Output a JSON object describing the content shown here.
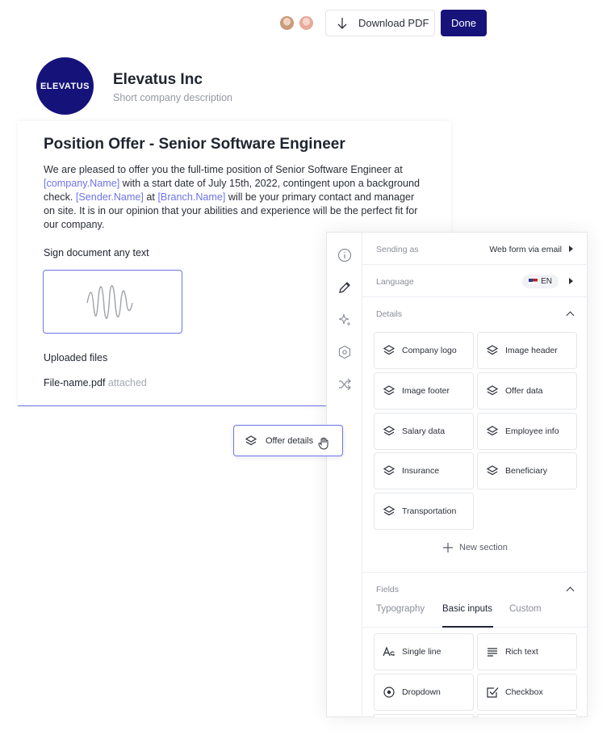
{
  "toolbar": {
    "download_label": "Download PDF",
    "done_label": "Done"
  },
  "company": {
    "logo_text": "ELEVATUS",
    "name": "Elevatus Inc",
    "description": "Short company description"
  },
  "document": {
    "title": "Position Offer - Senior Software Engineer",
    "body": [
      {
        "text": "We are pleased to offer you the full-time position of Senior Software Engineer at ",
        "placeholder": false
      },
      {
        "text": "[company.Name]",
        "placeholder": true
      },
      {
        "text": " with a start date of July 15th, 2022, contingent upon a background check. ",
        "placeholder": false
      },
      {
        "text": "[Sender.Name]",
        "placeholder": true
      },
      {
        "text": " at ",
        "placeholder": false
      },
      {
        "text": "[Branch.Name]",
        "placeholder": true
      },
      {
        "text": " will be your primary contact and manager on site. It is in our opinion that your abilities and experience will be the perfect fit for our company.",
        "placeholder": false
      }
    ],
    "sign_label": "Sign document any text",
    "uploaded_label": "Uploaded files",
    "file_name": "File-name.pdf",
    "file_status": "attached"
  },
  "drag_chip": {
    "label": "Offer details"
  },
  "panel": {
    "sending_as": {
      "label": "Sending as",
      "value": "Web form via email"
    },
    "language": {
      "label": "Language",
      "value": "EN"
    },
    "details": {
      "header": "Details",
      "items": [
        {
          "label": "Company logo"
        },
        {
          "label": "Image header"
        },
        {
          "label": "Image footer"
        },
        {
          "label": "Offer data"
        },
        {
          "label": "Salary data"
        },
        {
          "label": "Employee info"
        },
        {
          "label": "Insurance"
        },
        {
          "label": "Beneficiary"
        },
        {
          "label": "Transportation"
        }
      ],
      "new_section": "New section"
    },
    "fields": {
      "header": "Fields",
      "tabs": [
        {
          "label": "Typography",
          "active": false
        },
        {
          "label": "Basic inputs",
          "active": true
        },
        {
          "label": "Custom",
          "active": false
        }
      ],
      "items": [
        {
          "label": "Single line",
          "icon": "text-size-icon"
        },
        {
          "label": "Rich text",
          "icon": "paragraph-lines-icon"
        },
        {
          "label": "Dropdown",
          "icon": "radio-circle-icon"
        },
        {
          "label": "Checkbox",
          "icon": "checkbox-icon"
        }
      ]
    }
  }
}
